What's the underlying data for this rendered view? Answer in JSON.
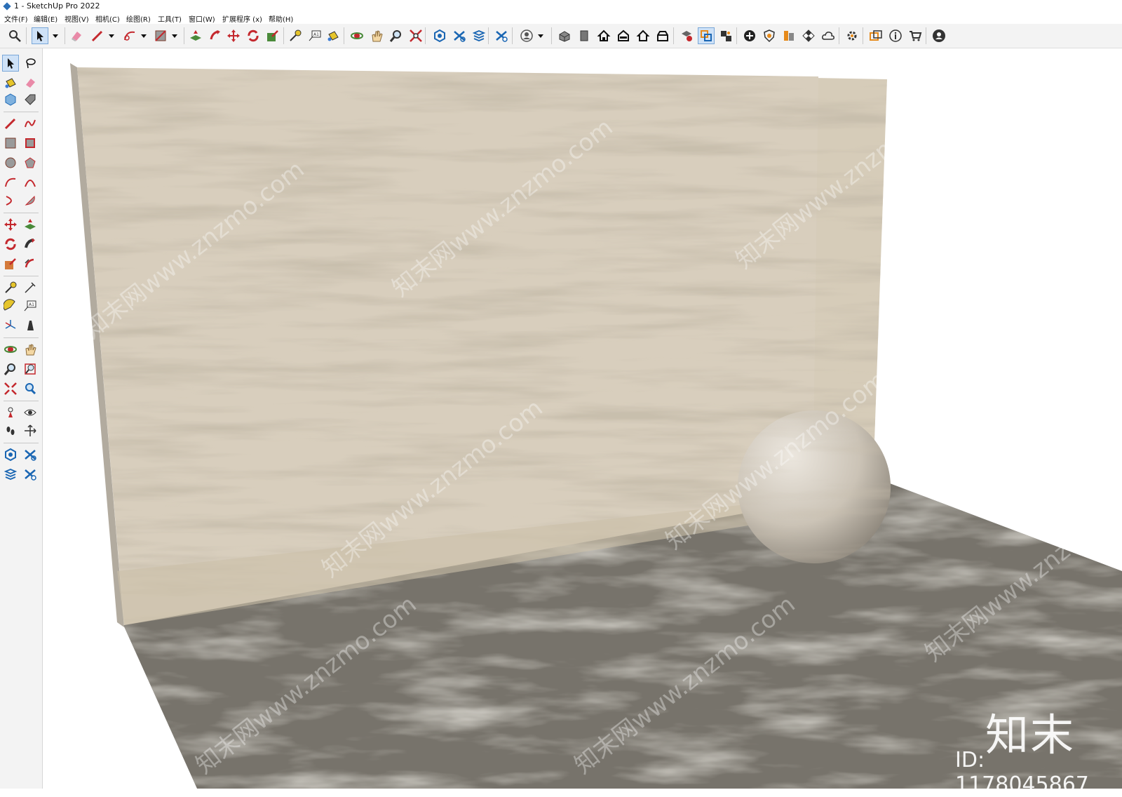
{
  "window": {
    "title": "1 - SketchUp Pro 2022"
  },
  "menu": [
    {
      "label": "文件(F)"
    },
    {
      "label": "编辑(E)"
    },
    {
      "label": "视图(V)"
    },
    {
      "label": "相机(C)"
    },
    {
      "label": "绘图(R)"
    },
    {
      "label": "工具(T)"
    },
    {
      "label": "窗口(W)"
    },
    {
      "label": "扩展程序 (x)"
    },
    {
      "label": "帮助(H)"
    }
  ],
  "watermark": {
    "logo": "知末",
    "id": "ID: 1178045867",
    "site": "知末网www.znzmo.com"
  },
  "colors": {
    "wall": "#d8cebd",
    "floor": "#77736b",
    "sphere": "#cfc8bd",
    "accent": "#2b6fb6"
  }
}
